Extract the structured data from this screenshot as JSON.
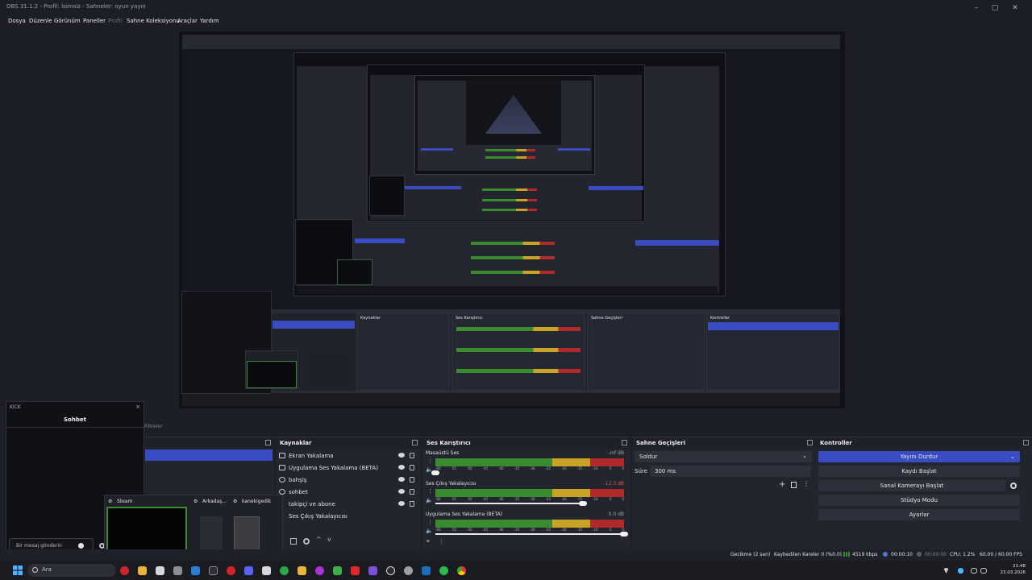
{
  "window": {
    "title": "OBS 31.1.2 - Profil: İsimsiz - Sahneler: oyun yayın",
    "minimize": "–",
    "maximize": "▢",
    "close": "✕"
  },
  "menu": [
    {
      "label": "Dosya",
      "disabled": false
    },
    {
      "label": "Düzenle",
      "disabled": false
    },
    {
      "label": "Görünüm",
      "disabled": false
    },
    {
      "label": "Paneller",
      "disabled": false
    },
    {
      "label": "Profil",
      "disabled": true
    },
    {
      "label": "Sahne Koleksiyonu",
      "disabled": false
    },
    {
      "label": "Araçlar",
      "disabled": false
    },
    {
      "label": "Yardım",
      "disabled": false
    }
  ],
  "filters_label": "Filtreler",
  "kick": {
    "title": "KICK",
    "close": "×",
    "chat_title": "Sohbet",
    "chat_placeholder": "Bir mesaj gönderin"
  },
  "steam_overlay": {
    "items": [
      {
        "label": "Steam",
        "icon": "steam-icon"
      },
      {
        "label": "Arkadaş...",
        "icon": "steam-icon"
      },
      {
        "label": "kanekigedik",
        "icon": "steam-icon"
      }
    ]
  },
  "docks": {
    "sources": {
      "title": "Kaynaklar",
      "items": [
        {
          "label": "Ekran Yakalama",
          "icon": "monitor-icon"
        },
        {
          "label": "Uygulama Ses Yakalama (BETA)",
          "icon": "speaker-icon"
        },
        {
          "label": "bahşiş",
          "icon": "globe-icon"
        },
        {
          "label": "sohbet",
          "icon": "globe-icon"
        },
        {
          "label": "takipçi ve abone",
          "icon": "text-icon"
        },
        {
          "label": "Ses Çıkış Yakalayıcısı",
          "icon": "speaker-icon"
        }
      ]
    },
    "mixer": {
      "title": "Ses Karıştırıcı",
      "channels": [
        {
          "name": "Masaüstü Ses",
          "db": "-inf dB",
          "db_color": "#9aa0ab",
          "level": 0.0
        },
        {
          "name": "Ses Çıkış Yakalayıcısı",
          "db": "-12.3 dB",
          "db_color": "#e05555",
          "level": 0.78
        },
        {
          "name": "Uygulama Ses Yakalama (BETA)",
          "db": "0.0 dB",
          "db_color": "#9aa0ab",
          "level": 1.0
        }
      ],
      "ticks": [
        "-60",
        "-55",
        "-50",
        "-45",
        "-40",
        "-35",
        "-30",
        "-25",
        "-20",
        "-15",
        "-10",
        "-5",
        "0"
      ]
    },
    "transitions": {
      "title": "Sahne Geçişleri",
      "type": "Soldur",
      "duration_label": "Süre",
      "duration": "300 ms"
    },
    "controls": {
      "title": "Kontroller",
      "buttons": [
        {
          "label": "Yayını Durdur",
          "active": true
        },
        {
          "label": "Kaydı Başlat"
        },
        {
          "label": "Sanal Kamerayı Başlat"
        },
        {
          "label": "Stüdyo Modu"
        },
        {
          "label": "Ayarlar"
        }
      ]
    }
  },
  "status": {
    "delay": "Gecikme (2 san)",
    "dropped": "Kaybedilen Kareler 0 (%0.0)",
    "bitrate": "4519 kbps",
    "stream_time": "00:00:10",
    "rec_time": "00:00:00",
    "cpu": "CPU: 1.2%",
    "fps": "60.00 / 60.00 FPS"
  },
  "taskbar": {
    "search_placeholder": "Ara",
    "time": "21:48",
    "date": "23.03.2026"
  },
  "colors": {
    "accent": "#3a4cc2",
    "meter_green": "#3a8a2f",
    "meter_yellow": "#c9a326",
    "meter_red": "#b02a2a"
  }
}
